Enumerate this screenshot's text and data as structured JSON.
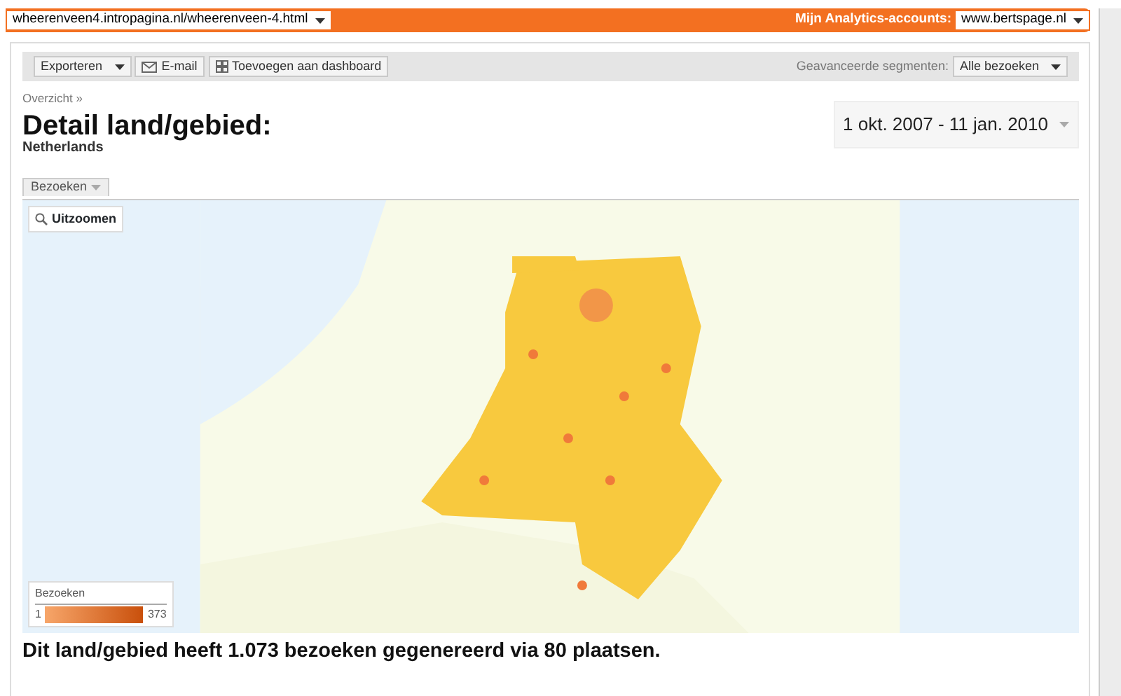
{
  "top_bar": {
    "site_selector": "wheerenveen4.intropagina.nl/wheerenveen-4.html",
    "accounts_label": "Mijn Analytics-accounts:",
    "account_selector": "www.bertspage.nl"
  },
  "toolbar": {
    "buttons": [
      {
        "label": "Exporteren",
        "kind": "dropdown"
      },
      {
        "label": "E-mail",
        "kind": "mail"
      },
      {
        "label": "Toevoegen aan dashboard",
        "kind": "dashboard"
      }
    ],
    "segments_label": "Geavanceerde segmenten:",
    "segments_selector": "Alle bezoeken"
  },
  "breadcrumb": "Overzicht »",
  "title": "Detail land/gebied:",
  "subtitle": "Netherlands",
  "date_range": "1 okt. 2007 - 11 jan. 2010",
  "metric_tab": "Bezoeken",
  "map": {
    "kind": "picture",
    "zoom_button": "Uitzoomen",
    "legend": {
      "title": "Bezoeken",
      "min": "1",
      "max": "373"
    }
  },
  "summary": "Dit land/gebied heeft 1.073 bezoeken gegenereerd via 80 plaatsen."
}
